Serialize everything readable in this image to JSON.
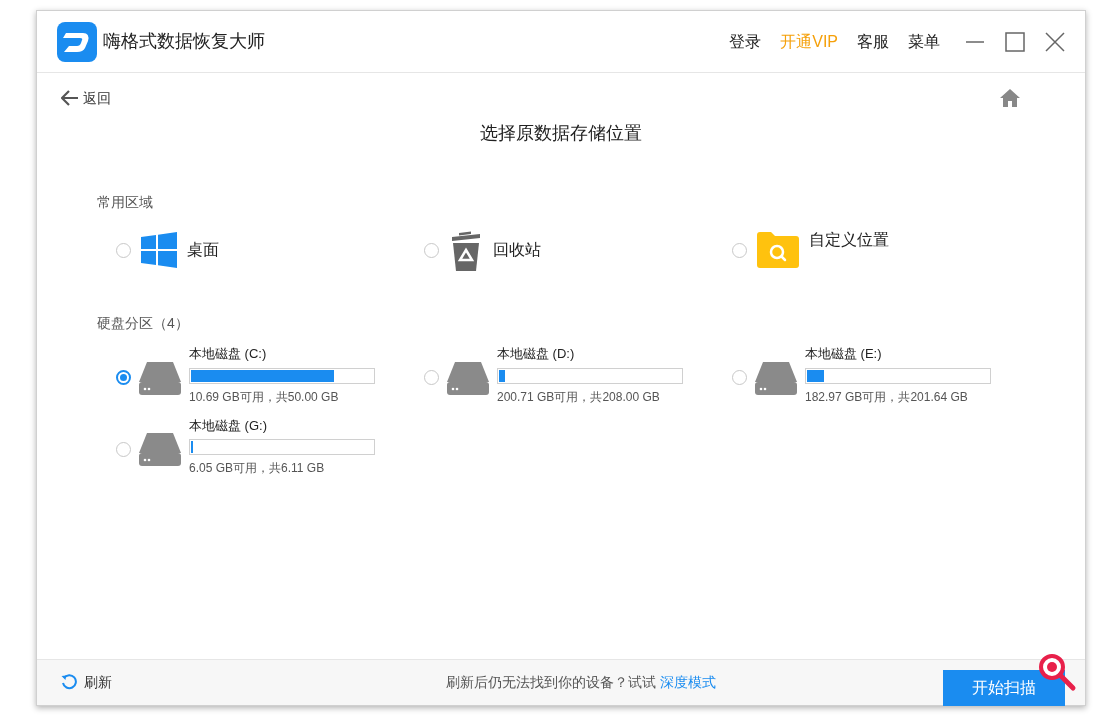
{
  "window": {
    "title": "嗨格式数据恢复大师"
  },
  "header_links": [
    {
      "label": "登录",
      "kind": "normal"
    },
    {
      "label": "开通VIP",
      "kind": "vip"
    },
    {
      "label": "客服",
      "kind": "normal"
    },
    {
      "label": "菜单",
      "kind": "normal"
    }
  ],
  "back": {
    "label": "返回"
  },
  "heading": "选择原数据存储位置",
  "common": {
    "title": "常用区域",
    "items": [
      {
        "label": "桌面",
        "kind": "desktop",
        "selected": false
      },
      {
        "label": "回收站",
        "kind": "recycle",
        "selected": false
      },
      {
        "label": "自定义位置",
        "kind": "folder",
        "selected": false
      }
    ]
  },
  "drives": {
    "title": "硬盘分区（4）",
    "items": [
      {
        "name": "本地磁盘 (C:)",
        "level": 0.786,
        "info": "10.69 GB可用，共50.00 GB",
        "selected": true
      },
      {
        "name": "本地磁盘 (D:)",
        "level": 0.035,
        "info": "200.71 GB可用，共208.00 GB",
        "selected": false
      },
      {
        "name": "本地磁盘 (E:)",
        "level": 0.093,
        "info": "182.97 GB可用，共201.64 GB",
        "selected": false
      },
      {
        "name": "本地磁盘 (G:)",
        "level": 0.01,
        "info": "6.05 GB可用，共6.11 GB",
        "selected": false
      }
    ]
  },
  "footer": {
    "refresh": "刷新",
    "hint": "刷新后仍无法找到你的设备？试试",
    "link": "深度模式",
    "scan_button": "开始扫描"
  }
}
